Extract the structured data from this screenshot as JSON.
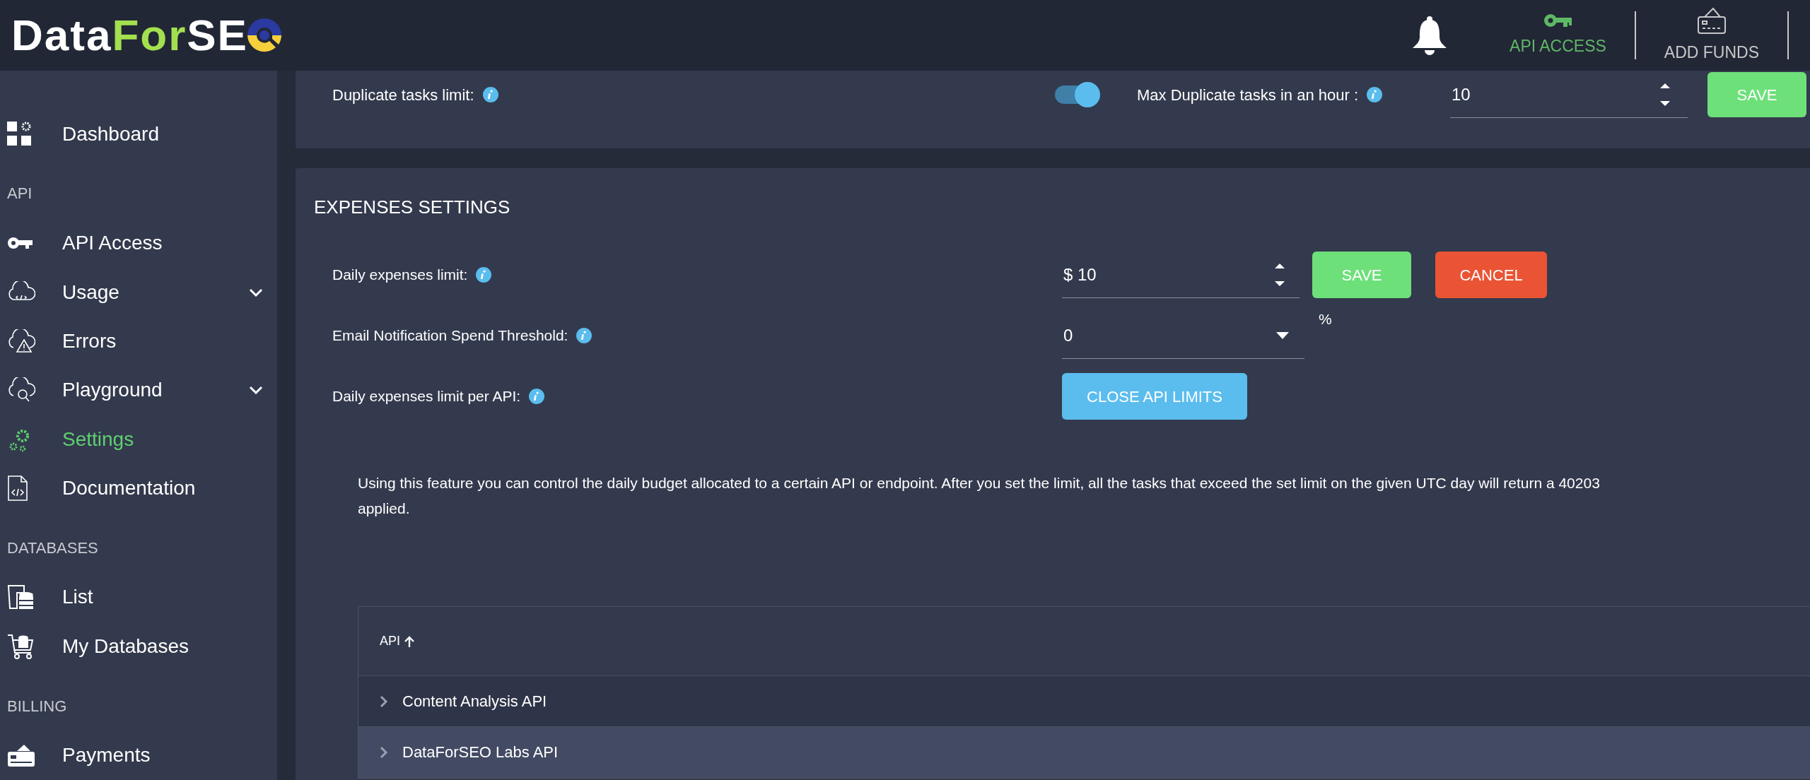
{
  "header": {
    "logo": {
      "part_1": "Data",
      "part_2": "For",
      "part_3": "SE"
    },
    "nav": [
      {
        "label": "API ACCESS",
        "selected": true
      },
      {
        "label": "ADD FUNDS",
        "selected": false
      }
    ]
  },
  "sidebar": {
    "entries": [
      {
        "kind": "item",
        "label": "Dashboard",
        "selected": false,
        "expandable": false
      },
      {
        "kind": "heading",
        "label": "API"
      },
      {
        "kind": "item",
        "label": "API Access",
        "selected": false,
        "expandable": false
      },
      {
        "kind": "item",
        "label": "Usage",
        "selected": false,
        "expandable": true
      },
      {
        "kind": "item",
        "label": "Errors",
        "selected": false,
        "expandable": false
      },
      {
        "kind": "item",
        "label": "Playground",
        "selected": false,
        "expandable": true
      },
      {
        "kind": "item",
        "label": "Settings",
        "selected": true,
        "expandable": false
      },
      {
        "kind": "item",
        "label": "Documentation",
        "selected": false,
        "expandable": false
      },
      {
        "kind": "heading",
        "label": "DATABASES"
      },
      {
        "kind": "item",
        "label": "List",
        "selected": false,
        "expandable": false
      },
      {
        "kind": "item",
        "label": "My Databases",
        "selected": false,
        "expandable": false
      },
      {
        "kind": "heading",
        "label": "BILLING"
      },
      {
        "kind": "item",
        "label": "Payments",
        "selected": false,
        "expandable": false
      }
    ]
  },
  "duplicates": {
    "label": "Duplicate tasks limit:",
    "on": true,
    "max_label": "Max Duplicate tasks in an hour :",
    "value": "10",
    "save": "SAVE"
  },
  "expenses": {
    "title": "EXPENSES SETTINGS",
    "daily_limit": {
      "label": "Daily expenses limit:",
      "value": "$ 10",
      "save": "SAVE",
      "cancel": "CANCEL"
    },
    "threshold": {
      "label": "Email Notification Spend Threshold:",
      "value": "0",
      "unit": "%"
    },
    "per_api": {
      "label": "Daily expenses limit per API:",
      "button": "CLOSE API LIMITS"
    },
    "description_lines": [
      "Using this feature you can control the daily budget allocated to a certain API or endpoint. After you set the limit, all the tasks that exceed the set limit on the given UTC day will return a 40203",
      "applied."
    ],
    "table": {
      "columns": [
        "API"
      ],
      "rows": [
        {
          "label": "Content Analysis API",
          "highlighted": false
        },
        {
          "label": "DataForSEO Labs API",
          "highlighted": true
        }
      ]
    }
  }
}
